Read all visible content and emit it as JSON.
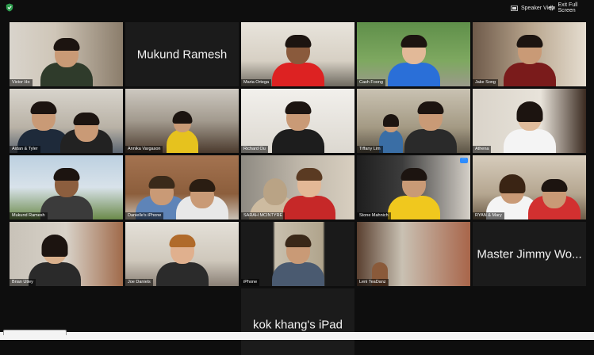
{
  "toolbar": {
    "speaker_view_label": "Speaker View",
    "exit_full_screen_label": "Exit Full Screen"
  },
  "colors": {
    "background": "#0e0e0e",
    "active_speaker_border": "#b5e36a",
    "accent": "#2d8cff"
  },
  "participants": [
    {
      "name": "Victor Ho",
      "video": true
    },
    {
      "name": "Mukund Ramesh",
      "video": false
    },
    {
      "name": "Maria Ortega",
      "video": true
    },
    {
      "name": "Cash Foong",
      "video": true
    },
    {
      "name": "Jake Song",
      "video": true
    },
    {
      "name": "Aidan & Tyler",
      "video": true
    },
    {
      "name": "Annika Vargason",
      "video": true
    },
    {
      "name": "Richard Ou",
      "video": true
    },
    {
      "name": "Tiffany Lim",
      "video": true,
      "active_speaker": true
    },
    {
      "name": "Athena",
      "video": true
    },
    {
      "name": "Mukund Ramesh",
      "video": true
    },
    {
      "name": "Danielle's iPhone",
      "video": true
    },
    {
      "name": "SARAH MCINTYRE",
      "video": true
    },
    {
      "name": "Stone Mahnich",
      "video": true,
      "options_icon": "more-options-icon"
    },
    {
      "name": "RYAN & Mary",
      "video": true
    },
    {
      "name": "Brian Utley",
      "video": true
    },
    {
      "name": "Joe Daniels",
      "video": true
    },
    {
      "name": "iPhone",
      "video": true
    },
    {
      "name": "Leni TeaDanz",
      "video": true
    },
    {
      "name": "Master Jimmy Wo...",
      "video": false
    },
    {
      "name": "kok khang's iPad",
      "video": false
    }
  ]
}
